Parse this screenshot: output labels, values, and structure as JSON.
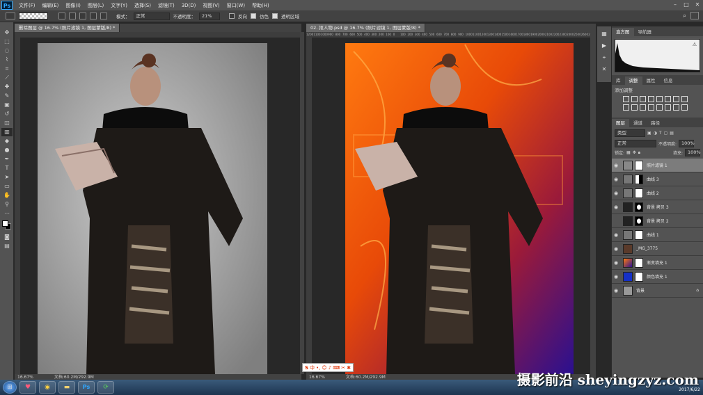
{
  "app": {
    "logo": "Ps"
  },
  "menu": [
    "文件(F)",
    "编辑(E)",
    "图像(I)",
    "图层(L)",
    "文字(Y)",
    "选择(S)",
    "滤镜(T)",
    "3D(D)",
    "视图(V)",
    "窗口(W)",
    "帮助(H)"
  ],
  "options": {
    "mode_label": "模式：",
    "mode_value": "正常",
    "opacity_label": "不透明度：",
    "opacity_value": "21%",
    "reverse_label": "反向",
    "dither_label": "仿色",
    "transparency_label": "透明区域"
  },
  "docs": [
    {
      "tab": "删除图层 @ 16.7% (照片滤镜 1, 图层蒙版/8) *",
      "zoom": "16.67%",
      "status": "文档:60.2M/292.9M"
    },
    {
      "tab": "02. 抠人物.psd @ 16.7% (照片滤镜 1, 图层蒙版/8) *",
      "zoom": "16.67%",
      "status": "文档:60.2M/292.9M"
    }
  ],
  "panels": {
    "histogram_tabs": [
      "直方图",
      "导航器"
    ],
    "adjust_tabs": [
      "库",
      "调整",
      "属性",
      "信息"
    ],
    "adjust_title": "添加调整",
    "layers_tabs": [
      "图层",
      "通道",
      "路径"
    ],
    "kind_label": "类型",
    "blend_mode": "正常",
    "opacity_label": "不透明度:",
    "opacity_value": "100%",
    "lock_label": "锁定:",
    "fill_label": "填充:",
    "fill_value": "100%"
  },
  "layers": [
    {
      "name": "照片滤镜 1",
      "visible": true,
      "selected": true
    },
    {
      "name": "曲线 3",
      "visible": true,
      "selected": false
    },
    {
      "name": "曲线 2",
      "visible": true,
      "selected": false
    },
    {
      "name": "背景 拷贝 3",
      "visible": true,
      "selected": false
    },
    {
      "name": "背景 拷贝 2",
      "visible": false,
      "selected": false
    },
    {
      "name": "曲线 1",
      "visible": true,
      "selected": false
    },
    {
      "name": "_MG_3775",
      "visible": true,
      "selected": false
    },
    {
      "name": "渐变填充 1",
      "visible": true,
      "selected": false
    },
    {
      "name": "颜色填充 1",
      "visible": true,
      "selected": false
    },
    {
      "name": "背景",
      "visible": true,
      "selected": false
    }
  ],
  "ruler_numbers": [
    "1200",
    "1100",
    "1000",
    "900",
    "800",
    "700",
    "600",
    "500",
    "400",
    "300",
    "200",
    "100",
    "0",
    "100",
    "200",
    "300",
    "400",
    "500",
    "600",
    "700",
    "800",
    "900",
    "1000",
    "1100",
    "1200",
    "1300",
    "1400",
    "1500",
    "1600",
    "1700",
    "1800",
    "1900",
    "2000",
    "2100",
    "2200",
    "2300",
    "2400",
    "2500",
    "2600",
    "2700"
  ],
  "watermark": "摄影前沿 sheyingzyz.com",
  "clock_date": "2017/6/22",
  "colors": {
    "ui_dark": "#535353",
    "accent": "#31a8ff",
    "canvas_bg": "#282828"
  }
}
